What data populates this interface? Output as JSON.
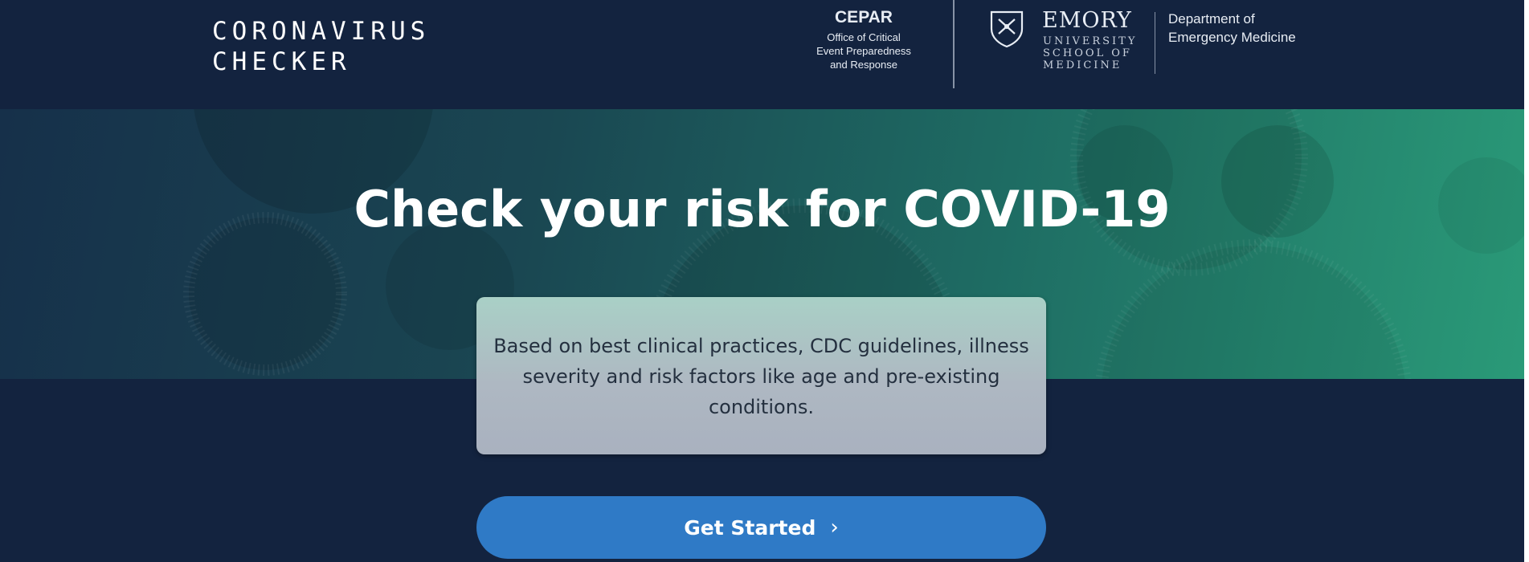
{
  "header": {
    "app_title": "CORONAVIRUS\nCHECKER",
    "cepar_name": "CEPAR",
    "cepar_description": "Office of Critical\nEvent Preparedness\nand Response",
    "emory_name": "EMORY",
    "emory_subtitle": "UNIVERSITY\nSCHOOL OF\nMEDICINE",
    "department": "Department of\nEmergency Medicine"
  },
  "hero": {
    "title": "Check your risk for COVID-19"
  },
  "info_card": {
    "text": "Based on best clinical practices, CDC guidelines, illness severity and risk factors like age and pre-existing conditions."
  },
  "cta": {
    "label": "Get Started",
    "icon": "chevron-right-icon"
  },
  "colors": {
    "background": "#13233f",
    "button": "#2f7ac6",
    "hero_start": "#16304a",
    "hero_end": "#2a9a78"
  }
}
